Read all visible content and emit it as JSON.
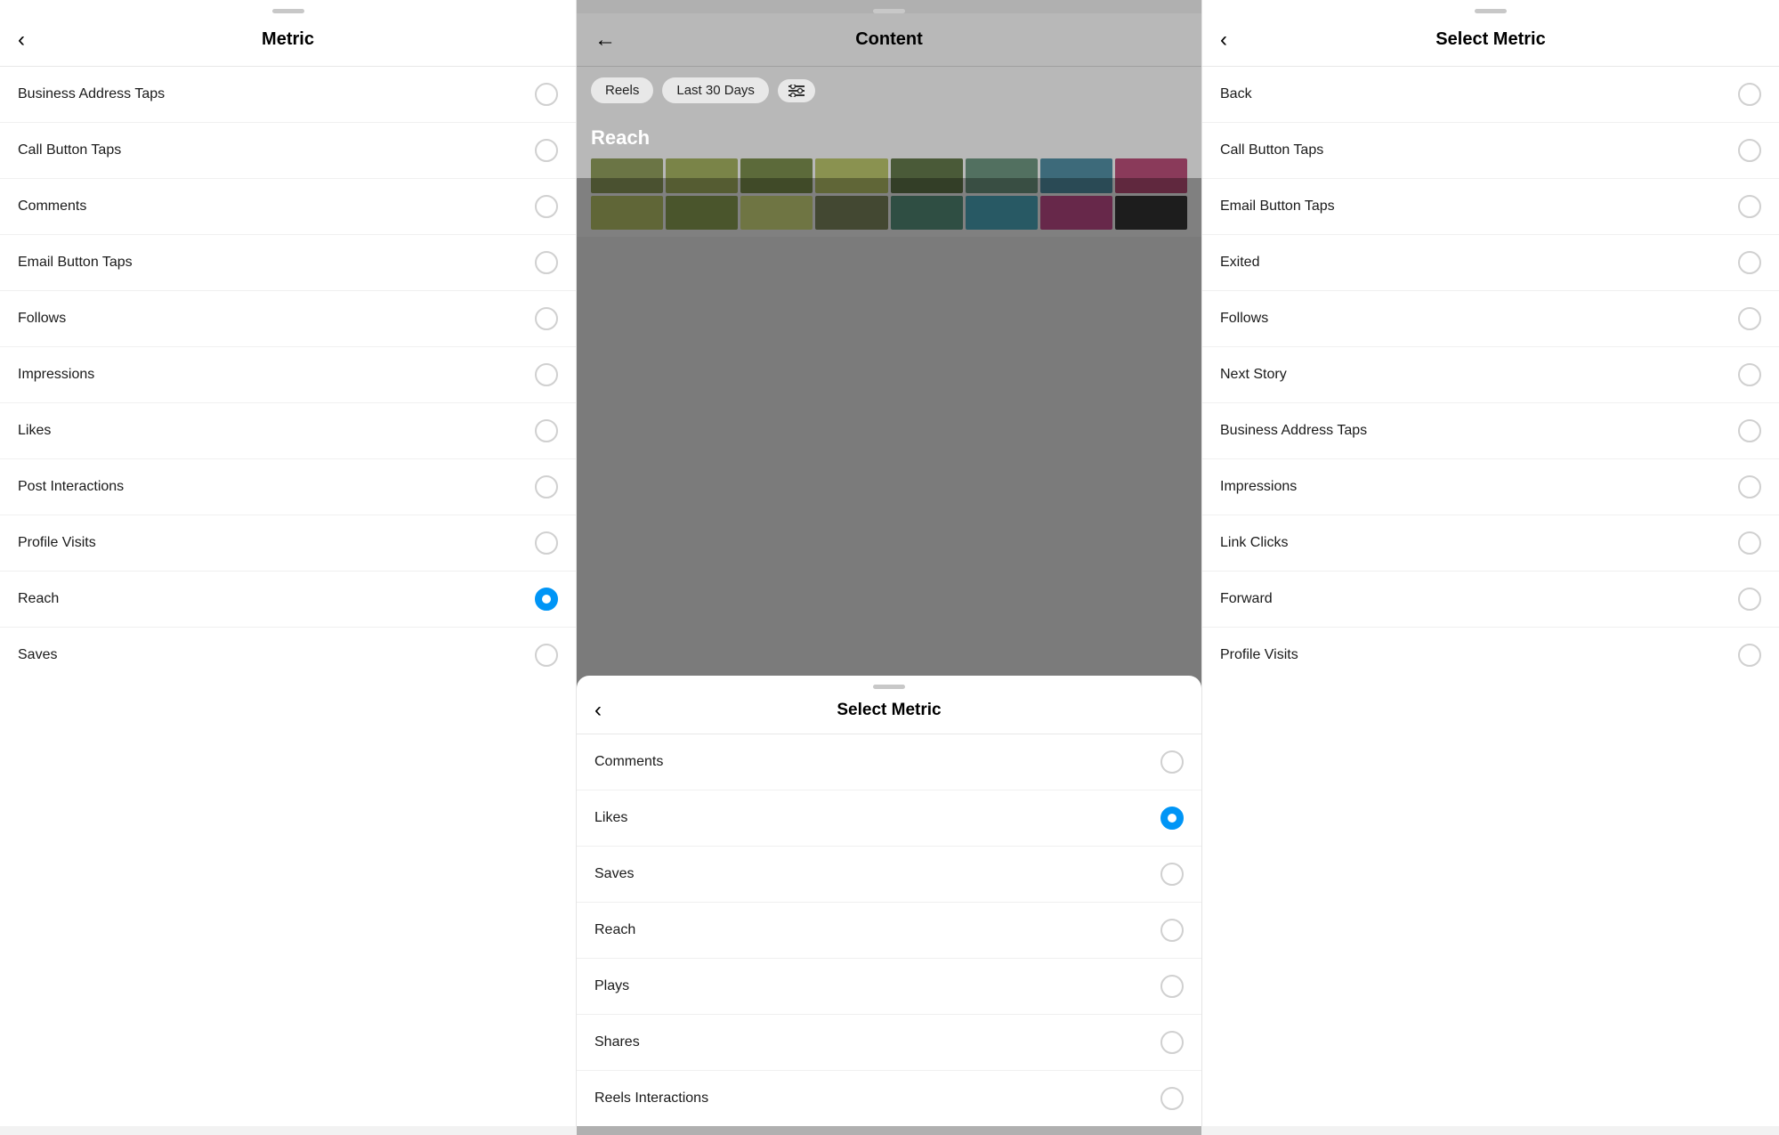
{
  "left_panel": {
    "drag_handle": true,
    "header": {
      "back_label": "‹",
      "title": "Metric"
    },
    "metrics": [
      {
        "label": "Business Address Taps",
        "selected": false
      },
      {
        "label": "Call Button Taps",
        "selected": false
      },
      {
        "label": "Comments",
        "selected": false
      },
      {
        "label": "Email Button Taps",
        "selected": false
      },
      {
        "label": "Follows",
        "selected": false
      },
      {
        "label": "Impressions",
        "selected": false
      },
      {
        "label": "Likes",
        "selected": false
      },
      {
        "label": "Post Interactions",
        "selected": false
      },
      {
        "label": "Profile Visits",
        "selected": false
      },
      {
        "label": "Reach",
        "selected": true
      },
      {
        "label": "Saves",
        "selected": false
      }
    ]
  },
  "middle_panel": {
    "header": {
      "back_label": "←",
      "title": "Content"
    },
    "filters": {
      "chip1": "Reels",
      "chip2": "Last 30 Days",
      "filter_icon": "⚙"
    },
    "reach_section": {
      "title": "Reach"
    },
    "color_cells": [
      "#6b7545",
      "#7a8448",
      "#5c6a3a",
      "#8a9250",
      "#4a5a38",
      "#527060",
      "#3d6a7a",
      "#8a3a5a",
      "#8a9250",
      "#6b7a40",
      "#a0a860",
      "#606848",
      "#447060",
      "#3a8090",
      "#943a6a",
      "#2a2a2a"
    ],
    "bottom_sheet": {
      "title": "Select Metric",
      "back_label": "‹",
      "metrics": [
        {
          "label": "Comments",
          "selected": false
        },
        {
          "label": "Likes",
          "selected": true
        },
        {
          "label": "Saves",
          "selected": false
        },
        {
          "label": "Reach",
          "selected": false
        },
        {
          "label": "Plays",
          "selected": false
        },
        {
          "label": "Shares",
          "selected": false
        },
        {
          "label": "Reels Interactions",
          "selected": false
        }
      ]
    }
  },
  "right_panel": {
    "drag_handle": true,
    "header": {
      "back_label": "‹",
      "title": "Select Metric"
    },
    "metrics": [
      {
        "label": "Back",
        "selected": false
      },
      {
        "label": "Call Button Taps",
        "selected": false
      },
      {
        "label": "Email Button Taps",
        "selected": false
      },
      {
        "label": "Exited",
        "selected": false
      },
      {
        "label": "Follows",
        "selected": false
      },
      {
        "label": "Next Story",
        "selected": false
      },
      {
        "label": "Business Address Taps",
        "selected": false
      },
      {
        "label": "Impressions",
        "selected": false
      },
      {
        "label": "Link Clicks",
        "selected": false
      },
      {
        "label": "Forward",
        "selected": false
      },
      {
        "label": "Profile Visits",
        "selected": false
      }
    ]
  },
  "colors": {
    "selected_blue": "#0095f6",
    "border_color": "#d0d0d0"
  }
}
